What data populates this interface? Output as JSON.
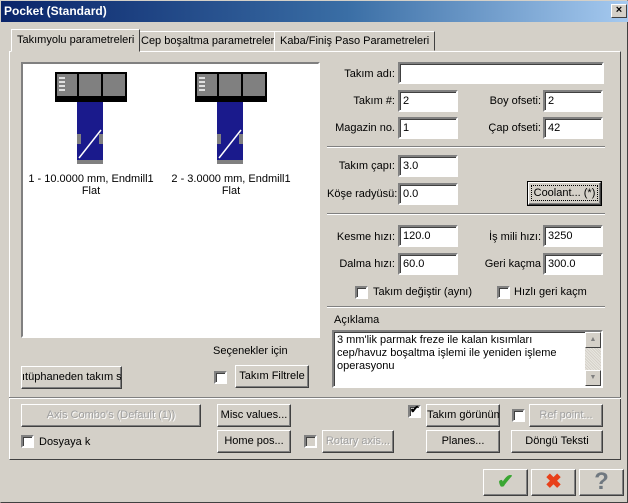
{
  "window": {
    "title": "Pocket (Standard)",
    "close_glyph": "×"
  },
  "tabs": [
    {
      "label": "Takımyolu parametreleri",
      "active": true
    },
    {
      "label": "Cep boşaltma parametreleri",
      "active": false
    },
    {
      "label": "Kaba/Finiş Paso Parametreleri",
      "active": false
    }
  ],
  "tools": [
    {
      "line1": "1 - 10.0000 mm, Endmill1",
      "line2": "Flat",
      "icon": "endmill-icon"
    },
    {
      "line1": "2 - 3.0000 mm, Endmill1",
      "line2": "Flat",
      "icon": "endmill-icon"
    }
  ],
  "colors": {
    "tool_body": "#1a1a8c",
    "tool_holder": "#808080",
    "titlebar_start": "#0a246a",
    "titlebar_end": "#a6caf0"
  },
  "fields": {
    "tool_name": {
      "label": "Takım adı:",
      "value": ""
    },
    "tool_number": {
      "label": "Takım #:",
      "value": "2"
    },
    "length_offset": {
      "label": "Boy ofseti:",
      "value": "2"
    },
    "magazine_no": {
      "label": "Magazin no.",
      "value": "1"
    },
    "diameter_offset": {
      "label": "Çap ofseti:",
      "value": "42"
    },
    "tool_diameter": {
      "label": "Takım çapı:",
      "value": "3.0"
    },
    "corner_radius": {
      "label": "Köşe radyüsü:",
      "value": "0.0"
    },
    "feed_rate": {
      "label": "Kesme hızı:",
      "value": "120.0"
    },
    "spindle_speed": {
      "label": "İş mili hızı:",
      "value": "3250"
    },
    "plunge_rate": {
      "label": "Dalma hızı:",
      "value": "60.0"
    },
    "retract_rate": {
      "label": "Geri kaçma",
      "value": "300.0"
    }
  },
  "checkboxes": {
    "tool_change": {
      "label": "Takım değiştir (aynı)",
      "checked": false
    },
    "rapid_retract": {
      "label": "Hızlı geri kaçm",
      "checked": false
    },
    "filter": {
      "checked": false
    },
    "save_to_file": {
      "label": "Dosyaya k",
      "checked": false
    },
    "tool_display": {
      "checked": true
    },
    "ref_point": {
      "checked": false
    },
    "rotary_axis": {
      "checked": false
    }
  },
  "buttons": {
    "coolant": "Coolant... (*)",
    "library_select": "ıtüphaneden takım s",
    "filter": "Takım Filtrele",
    "axis_combo": "Axis Combo's (Default (1))",
    "misc_values": "Misc values...",
    "home_pos": "Home pos...",
    "rotary_axis": "Rotary axis...",
    "tool_display": "Takım görünümü",
    "ref_point": "Ref point...",
    "planes": "Planes...",
    "cycle_text": "Döngü Teksti"
  },
  "options_label": "Seçenekler için",
  "comment": {
    "label": "Açıklama",
    "text": "3 mm'lik parmak freze ile kalan kısımları cep/havuz boşaltma işlemi ile yeniden işleme operasyonu"
  },
  "dialog_buttons": {
    "ok_glyph": "✔",
    "cancel_glyph": "✖",
    "help_glyph": "?"
  }
}
